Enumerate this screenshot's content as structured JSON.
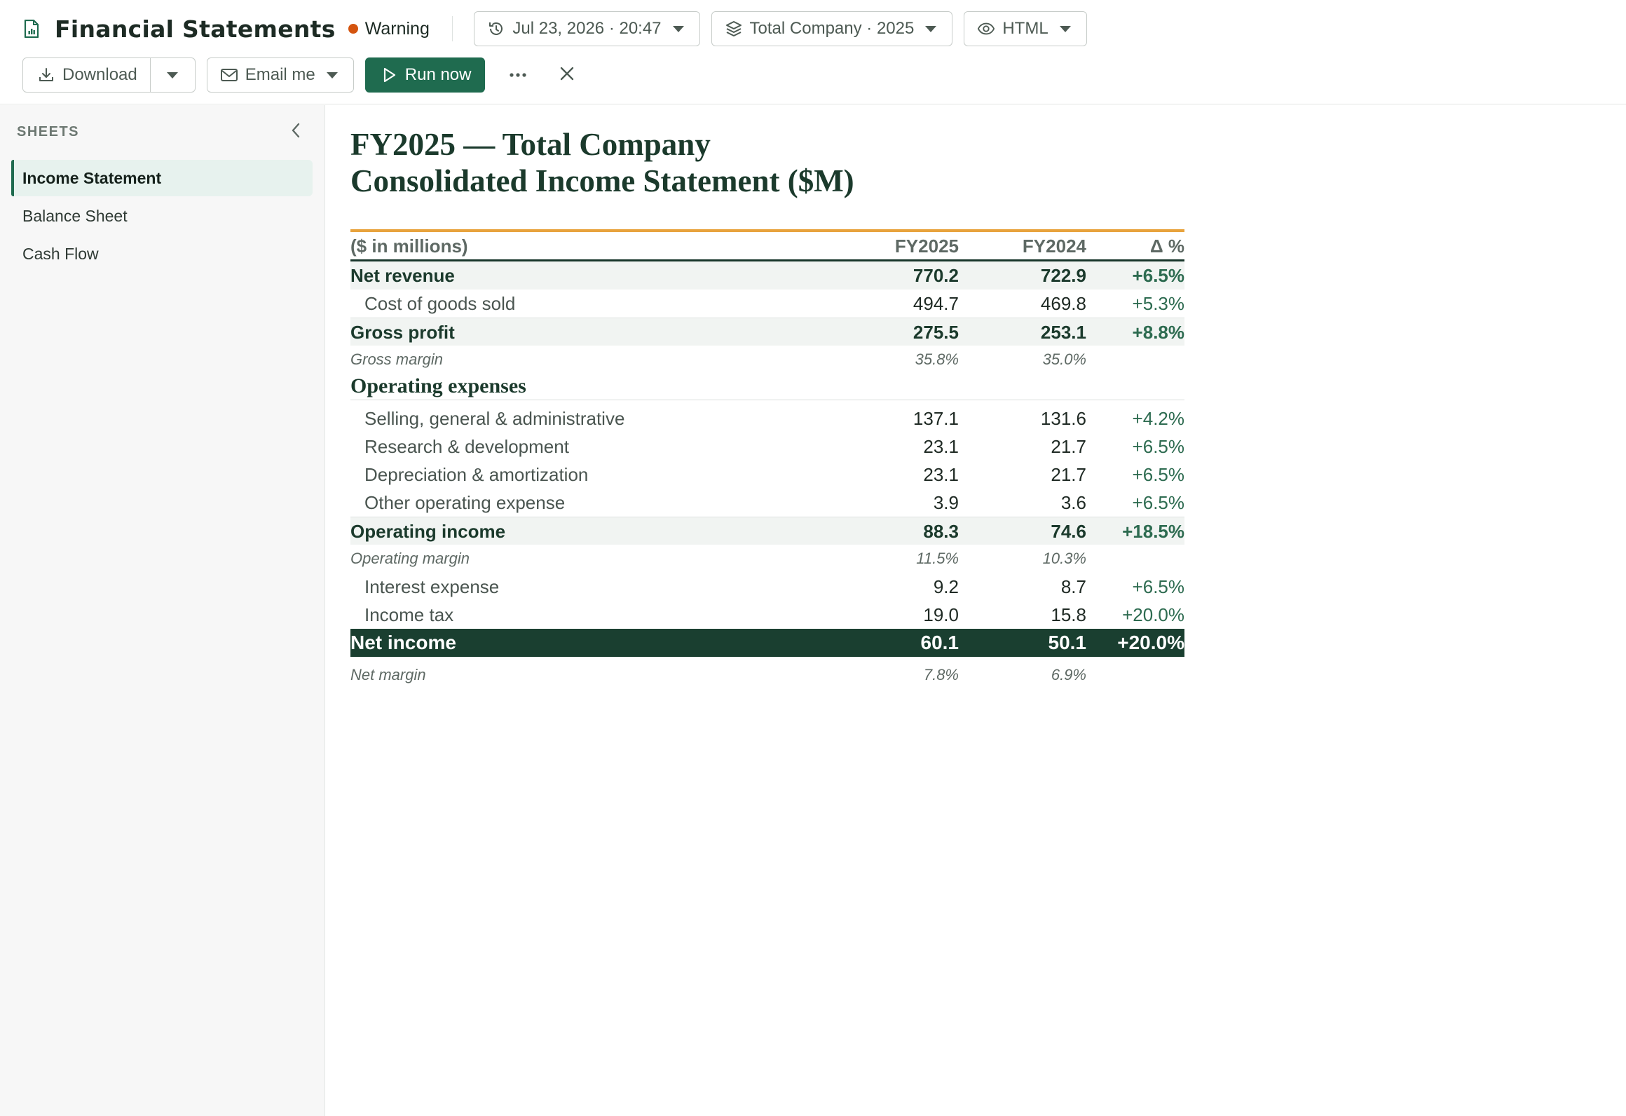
{
  "header": {
    "title": "Financial Statements",
    "status": "Warning",
    "status_color": "#d4540f",
    "run_timestamp": "Jul 23, 2026 · 20:47",
    "scope": "Total Company · 2025",
    "format": "HTML"
  },
  "toolbar": {
    "download_label": "Download",
    "email_label": "Email me",
    "run_label": "Run now",
    "accent": "#1f6b4f"
  },
  "sidebar": {
    "heading": "SHEETS",
    "items": [
      {
        "label": "Income Statement",
        "active": true
      },
      {
        "label": "Balance Sheet",
        "active": false
      },
      {
        "label": "Cash Flow",
        "active": false
      }
    ]
  },
  "report": {
    "title_line1": "FY2025 — Total Company",
    "title_line2": "Consolidated Income Statement  ($M)",
    "columns": [
      "($ in millions)",
      "FY2025",
      "FY2024",
      "Δ %"
    ],
    "rows": {
      "net_revenue": [
        "Net revenue",
        "770.2",
        "722.9",
        "+6.5%"
      ],
      "cogs": [
        "Cost of goods sold",
        "494.7",
        "469.8",
        "+5.3%"
      ],
      "gross_profit": [
        "Gross profit",
        "275.5",
        "253.1",
        "+8.8%"
      ],
      "gross_margin": [
        "Gross margin",
        "35.8%",
        "35.0%"
      ],
      "opex_heading": "Operating expenses",
      "sga": [
        "Selling, general & administrative",
        "137.1",
        "131.6",
        "+4.2%"
      ],
      "rnd": [
        "Research & development",
        "23.1",
        "21.7",
        "+6.5%"
      ],
      "dna": [
        "Depreciation & amortization",
        "23.1",
        "21.7",
        "+6.5%"
      ],
      "other_opex": [
        "Other operating expense",
        "3.9",
        "3.6",
        "+6.5%"
      ],
      "operating_income": [
        "Operating income",
        "88.3",
        "74.6",
        "+18.5%"
      ],
      "operating_margin": [
        "Operating margin",
        "11.5%",
        "10.3%"
      ],
      "interest": [
        "Interest expense",
        "9.2",
        "8.7",
        "+6.5%"
      ],
      "tax": [
        "Income tax",
        "19.0",
        "15.8",
        "+20.0%"
      ],
      "net_income": [
        "Net income",
        "60.1",
        "50.1",
        "+20.0%"
      ],
      "net_margin": [
        "Net margin",
        "7.8%",
        "6.9%"
      ]
    }
  }
}
